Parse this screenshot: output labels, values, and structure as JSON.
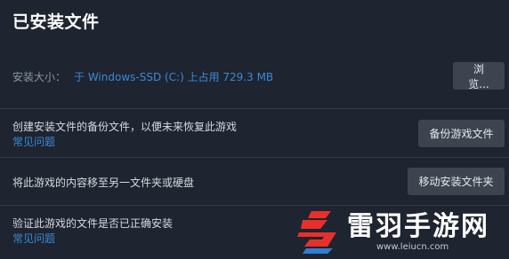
{
  "page": {
    "title": "已安装文件"
  },
  "install_size": {
    "label": "安装大小：",
    "value": "于 Windows-SSD (C:) 上占用 729.3 MB",
    "browse_label": "浏览..."
  },
  "backup": {
    "text": "创建安装文件的备份文件，以便未来恢复此游戏",
    "faq_label": "常见问题",
    "button_label": "备份游戏文件"
  },
  "move": {
    "text": "将此游戏的内容移至另一文件夹或硬盘",
    "button_label": "移动安装文件夹"
  },
  "verify": {
    "text": "验证此游戏的文件是否已正确安装",
    "faq_label": "常见问题"
  },
  "watermark": {
    "name": "雷羽手游网",
    "url": "www.leiucn.com"
  },
  "colors": {
    "background": "#1e2430",
    "link": "#3a8ad6",
    "button": "#3d4450",
    "logo_red": "#e8302a",
    "logo_blue": "#2e7fd6"
  }
}
